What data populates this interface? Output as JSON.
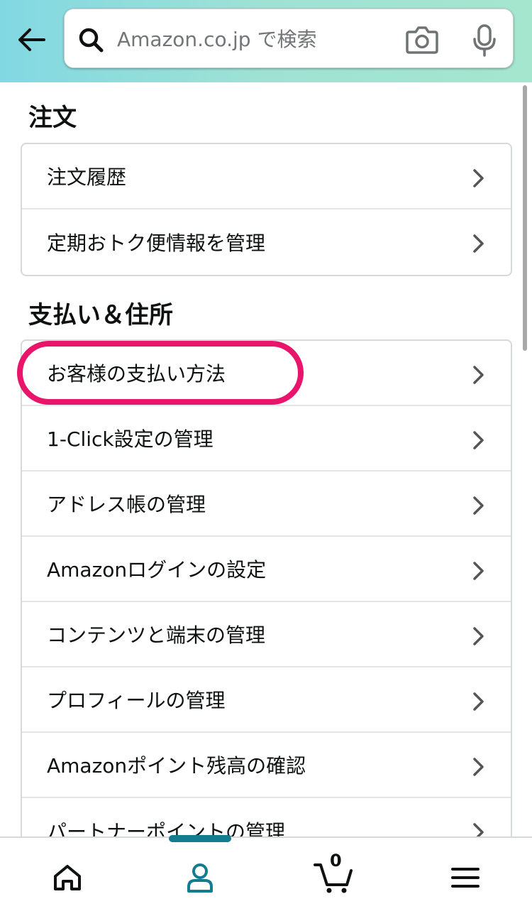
{
  "search": {
    "placeholder": "Amazon.co.jp で検索"
  },
  "icons": {
    "back": "arrow-left-icon",
    "search": "search-icon",
    "camera": "camera-icon",
    "mic": "microphone-icon",
    "chevron": "chevron-right-icon"
  },
  "colors": {
    "header_gradient_start": "#82d8e2",
    "header_gradient_end": "#a5e6cf",
    "highlight": "#e8156a",
    "active_nav": "#137c8f"
  },
  "sections": [
    {
      "title": "注文",
      "items": [
        {
          "label": "注文履歴"
        },
        {
          "label": "定期おトク便情報を管理"
        }
      ]
    },
    {
      "title": "支払い＆住所",
      "items": [
        {
          "label": "お客様の支払い方法",
          "highlighted": true
        },
        {
          "label": "1-Click設定の管理"
        },
        {
          "label": "アドレス帳の管理"
        },
        {
          "label": "Amazonログインの設定"
        },
        {
          "label": "コンテンツと端末の管理"
        },
        {
          "label": "プロフィールの管理"
        },
        {
          "label": "Amazonポイント残高の確認"
        },
        {
          "label": "パートナーポイントの管理"
        }
      ]
    }
  ],
  "bottom_nav": {
    "items": [
      {
        "icon": "home-icon"
      },
      {
        "icon": "account-icon",
        "active": true
      },
      {
        "icon": "cart-icon",
        "count": "0"
      },
      {
        "icon": "menu-icon"
      }
    ]
  }
}
